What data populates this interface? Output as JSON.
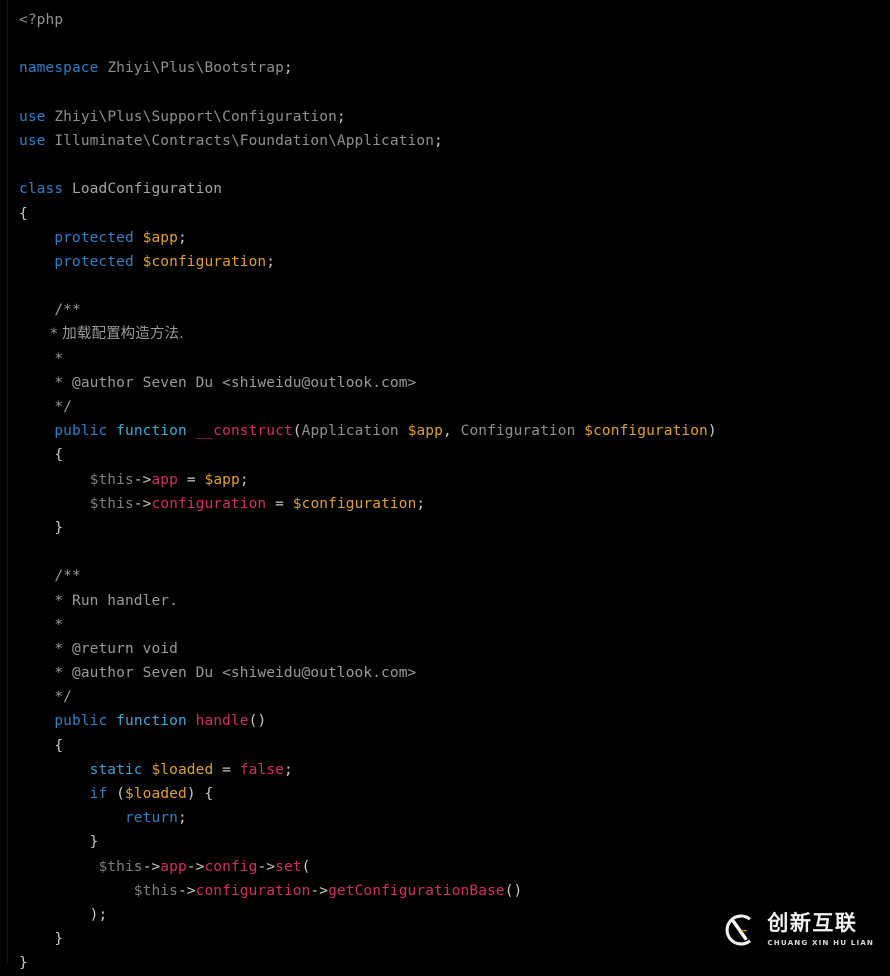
{
  "editor": {
    "background_color": "#000000",
    "language": "php",
    "font_size_px": 14.5
  },
  "palette": {
    "keyword": "#2f7fc4",
    "function_keyword": "#3fa9d4",
    "type": "#8f8f8f",
    "variable": "#e0a030",
    "this": "#7e7e7e",
    "method": "#d12e63",
    "constant": "#d12e63",
    "comment": "#9a9a9a",
    "punctuation": "#c8c8c8",
    "background": "#000000"
  },
  "code": {
    "open_tag": "<?php",
    "namespace_keyword": "namespace",
    "namespace_path": "Zhiyi\\Plus\\Bootstrap",
    "use_keyword": "use",
    "use_1_path": "Zhiyi\\Plus\\Support\\Configuration",
    "use_2_path": "Illuminate\\Contracts\\Foundation\\Application",
    "class_keyword": "class",
    "class_name": "LoadConfiguration",
    "brace_open": "{",
    "brace_close": "}",
    "protected_keyword": "protected",
    "prop_app": "$app",
    "prop_configuration": "$configuration",
    "semicolon": ";",
    "doc_open": "/**",
    "doc_star": " *",
    "doc_close": " */",
    "doc1_desc": " * 加载配置构造方法.",
    "doc1_author": " * @author Seven Du <shiweidu@outlook.com>",
    "doc2_desc": " * Run handler.",
    "doc2_return": " * @return void",
    "doc2_author": " * @author Seven Du <shiweidu@outlook.com>",
    "public_keyword": "public",
    "function_keyword": "function",
    "ctor_name": "__construct",
    "paren_open": "(",
    "paren_close": ")",
    "type_application": "Application",
    "type_configuration": "Configuration",
    "arg_app": "$app",
    "arg_comma": ",",
    "arg_configuration": "$configuration",
    "this_var": "$this",
    "arrow": "->",
    "member_app": "app",
    "member_configuration": "configuration",
    "assign": "=",
    "handle_name": "handle",
    "static_keyword": "static",
    "var_loaded": "$loaded",
    "const_false": "false",
    "if_keyword": "if",
    "return_keyword": "return",
    "member_config": "config",
    "member_set": "set",
    "member_get_configuration_base": "getConfigurationBase",
    "paren_close_semicolon": ");",
    "empty_parens": "()"
  },
  "watermark": {
    "logo_name": "cx-logo-icon",
    "chinese_name": "创新互联",
    "pinyin": "CHUANG XIN HU LIAN",
    "arc_color": "#f2f2f2",
    "x_color": "#f0b429"
  }
}
